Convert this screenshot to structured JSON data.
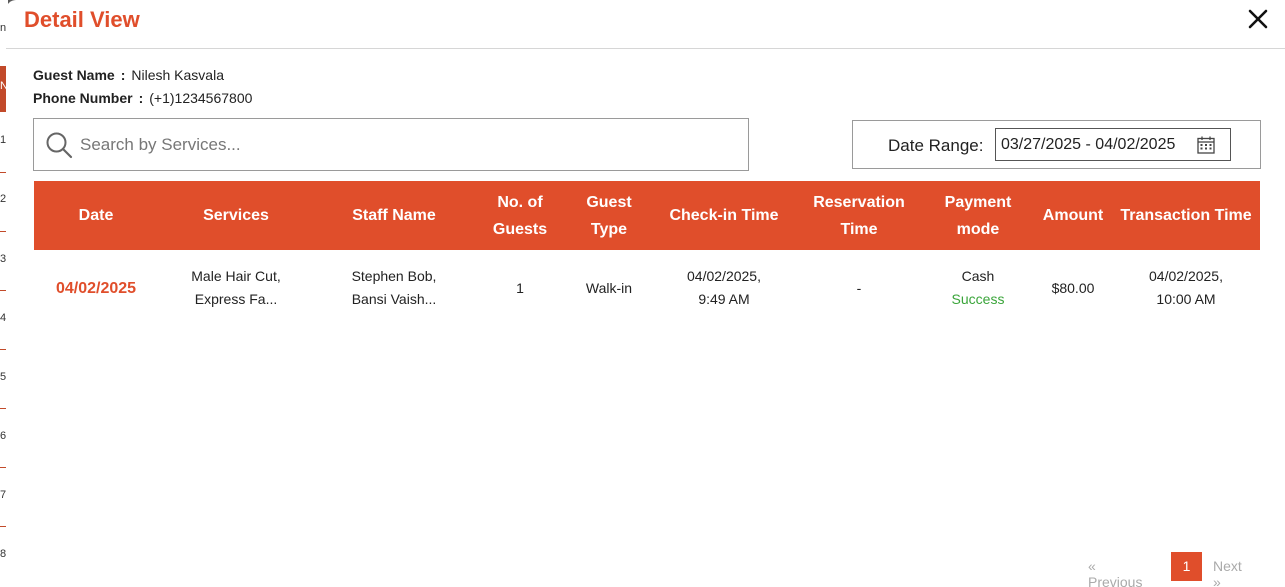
{
  "modal": {
    "title": "Detail View",
    "close_icon": "close-icon"
  },
  "guest": {
    "name_label": "Guest Name",
    "name_sep": ":",
    "name_value": "Nilesh Kasvala",
    "phone_label": "Phone Number",
    "phone_sep": ":",
    "phone_value": "(+1)1234567800"
  },
  "search": {
    "placeholder": "Search by Services...",
    "value": "",
    "icon": "search-icon"
  },
  "date_range": {
    "label": "Date Range:",
    "value": "03/27/2025 - 04/02/2025",
    "icon": "calendar-icon"
  },
  "table": {
    "headers": {
      "date": "Date",
      "services": "Services",
      "staff": "Staff Name",
      "guests_1": "No. of",
      "guests_2": "Guests",
      "type_1": "Guest",
      "type_2": "Type",
      "checkin": "Check-in Time",
      "reservation_1": "Reservation",
      "reservation_2": "Time",
      "payment_1": "Payment",
      "payment_2": "mode",
      "amount": "Amount",
      "transaction": "Transaction Time"
    },
    "rows": [
      {
        "date": "04/02/2025",
        "services_1": "Male Hair Cut,",
        "services_2": "Express Fa...",
        "staff_1": "Stephen Bob,",
        "staff_2": "Bansi Vaish...",
        "guests": "1",
        "type": "Walk-in",
        "checkin_1": "04/02/2025,",
        "checkin_2": "9:49 AM",
        "reservation": "-",
        "payment_mode": "Cash",
        "payment_status": "Success",
        "amount": "$80.00",
        "transaction_1": "04/02/2025,",
        "transaction_2": "10:00 AM"
      }
    ]
  },
  "pagination": {
    "prev": "«  Previous",
    "current": "1",
    "next": "Next  »"
  },
  "background_page": {
    "row_numbers": [
      "n",
      "N",
      "1",
      "2",
      "3",
      "4",
      "5",
      "6",
      "7",
      "8"
    ]
  },
  "colors": {
    "accent": "#e04e2b",
    "success": "#3aa53a"
  }
}
